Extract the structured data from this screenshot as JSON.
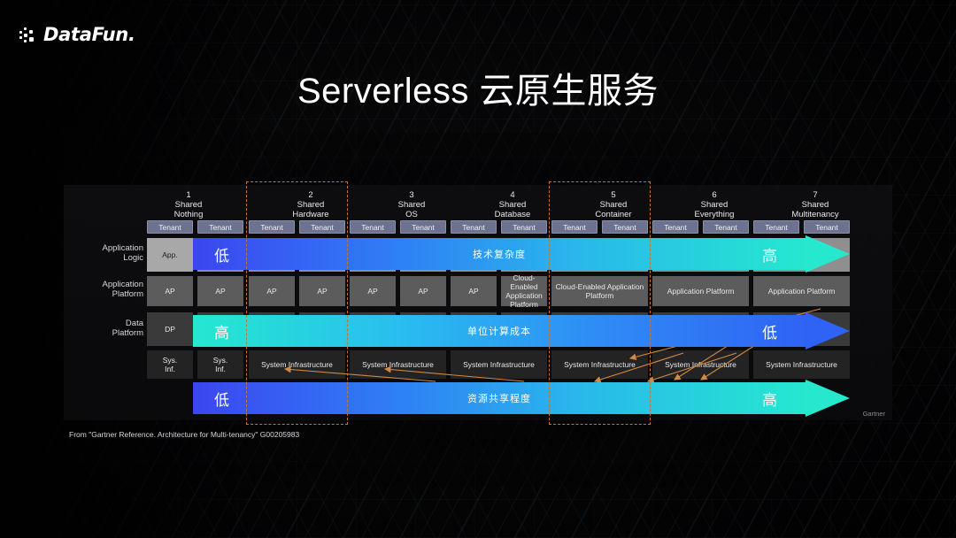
{
  "brand": {
    "name": "DataFun."
  },
  "title": "Serverless 云原生服务",
  "diagram": {
    "columns": [
      {
        "num": "1",
        "line1": "Shared",
        "line2": "Nothing"
      },
      {
        "num": "2",
        "line1": "Shared",
        "line2": "Hardware"
      },
      {
        "num": "3",
        "line1": "Shared",
        "line2": "OS"
      },
      {
        "num": "4",
        "line1": "Shared",
        "line2": "Database"
      },
      {
        "num": "5",
        "line1": "Shared",
        "line2": "Container"
      },
      {
        "num": "6",
        "line1": "Shared",
        "line2": "Everything"
      },
      {
        "num": "7",
        "line1": "Shared",
        "line2": "Multitenancy"
      }
    ],
    "tenant_label": "Tenant",
    "tenant_count": 14,
    "rows": [
      {
        "key": "application_logic",
        "line1": "Application",
        "line2": "Logic"
      },
      {
        "key": "application_platform",
        "line1": "Application",
        "line2": "Platform"
      },
      {
        "key": "data_platform",
        "line1": "Data",
        "line2": "Platform"
      }
    ],
    "first_col_cells": {
      "app": "App.",
      "ap": "AP",
      "dp": "DP",
      "sys_inf_1": "Sys.\nInf.",
      "sys_inf_2": "Sys.\nInf."
    },
    "app_platform_cells": [
      "AP",
      "AP",
      "AP",
      "AP",
      "AP",
      "AP",
      "AP",
      "Cloud-Enabled Application Platform",
      "Cloud-Enabled Application Platform",
      "Application Platform"
    ],
    "sys_inf_cells": [
      "Sys. Inf.",
      "Sys. Inf.",
      "System Infrastructure",
      "System Infrastructure",
      "System Infrastructure",
      "System Infrastructure",
      "System Infrastructure",
      "System Infrastructure"
    ],
    "arrows": [
      {
        "key": "tech_complexity",
        "start": "低",
        "label": "技术复杂度",
        "end": "高",
        "from_color": "#3b46f0",
        "to_color": "#25e8cf",
        "direction": "right"
      },
      {
        "key": "unit_compute_cost",
        "start": "高",
        "label": "单位计算成本",
        "end": "低",
        "from_color": "#25e8cf",
        "to_color": "#2f63f5",
        "direction": "right"
      },
      {
        "key": "resource_sharing",
        "start": "低",
        "label": "资源共享程度",
        "end": "高",
        "from_color": "#3b46f0",
        "to_color": "#25e8cf",
        "direction": "right"
      }
    ],
    "highlighted_columns": [
      "2",
      "5"
    ],
    "attribution": "Gartner"
  },
  "source_note": "From  \"Gartner Reference. Architecture for Multi-tenancy\"  G00205983",
  "colors": {
    "background": "#030304",
    "panel": "#0e0e10",
    "tenant": "#6c7290",
    "highlight_dash": "#c9742a",
    "arrow_blue": "#2f63f5",
    "arrow_cyan": "#25e8cf",
    "title_text": "#ffffff"
  }
}
